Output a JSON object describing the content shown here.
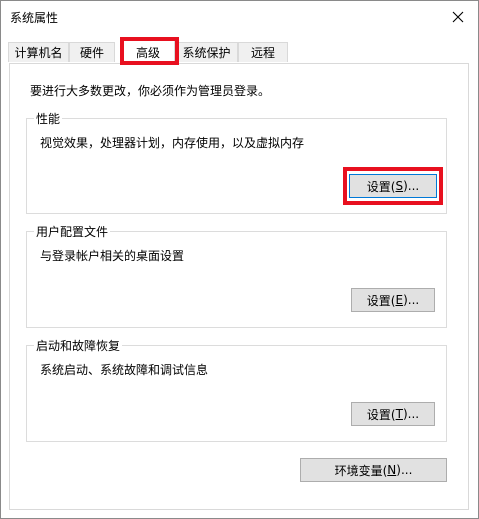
{
  "window": {
    "title": "系统属性"
  },
  "tabs": [
    {
      "label": "计算机名",
      "active": false
    },
    {
      "label": "硬件",
      "active": false
    },
    {
      "label": "高级",
      "active": true
    },
    {
      "label": "系统保护",
      "active": false
    },
    {
      "label": "远程",
      "active": false
    }
  ],
  "advanced": {
    "admin_note": "要进行大多数更改，你必须作为管理员登录。",
    "performance": {
      "title": "性能",
      "description": "视觉效果，处理器计划，内存使用，以及虚拟内存",
      "button": {
        "prefix": "设置(",
        "accel": "S",
        "suffix": ")..."
      }
    },
    "user_profiles": {
      "title": "用户配置文件",
      "description": "与登录帐户相关的桌面设置",
      "button": {
        "prefix": "设置(",
        "accel": "E",
        "suffix": ")..."
      }
    },
    "startup_recovery": {
      "title": "启动和故障恢复",
      "description": "系统启动、系统故障和调试信息",
      "button": {
        "prefix": "设置(",
        "accel": "T",
        "suffix": ")..."
      }
    },
    "env_button": {
      "prefix": "环境变量(",
      "accel": "N",
      "suffix": ")..."
    }
  },
  "colors": {
    "highlight": "#e8101f",
    "focus": "#0078d7"
  }
}
